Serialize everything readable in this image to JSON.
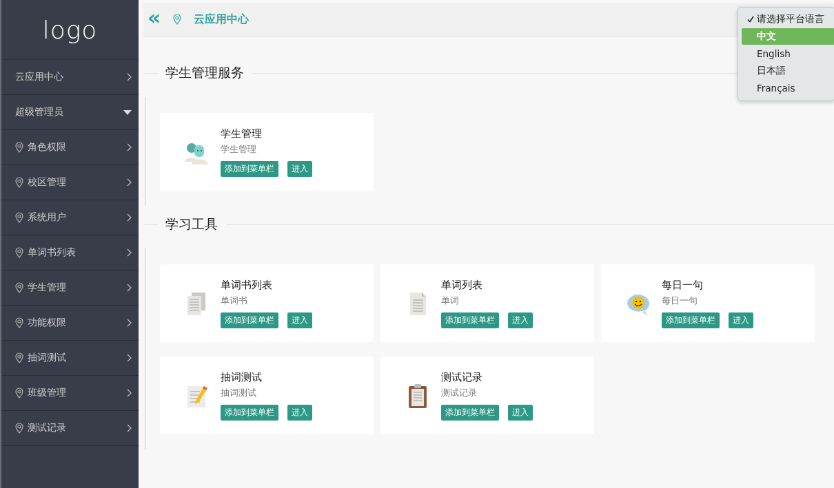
{
  "sidebar": {
    "logo": "logo",
    "items": [
      {
        "label": "云应用中心",
        "expanded": false
      },
      {
        "label": "超级管理员",
        "expanded": true,
        "children": [
          {
            "label": "角色权限",
            "expanded": false
          },
          {
            "label": "校区管理",
            "expanded": false
          },
          {
            "label": "系统用户",
            "expanded": false
          },
          {
            "label": "单词书列表",
            "expanded": false
          },
          {
            "label": "学生管理",
            "expanded": false
          },
          {
            "label": "功能权限",
            "expanded": false
          },
          {
            "label": "抽词测试",
            "expanded": false
          },
          {
            "label": "班级管理",
            "expanded": false
          },
          {
            "label": "测试记录",
            "expanded": false
          }
        ]
      }
    ]
  },
  "header": {
    "collapse_icon": "«",
    "breadcrumb": "云应用中心"
  },
  "language_menu": {
    "options": [
      {
        "label": "请选择平台语言",
        "checked": true,
        "selected": false
      },
      {
        "label": "中文",
        "checked": false,
        "selected": true
      },
      {
        "label": "English",
        "checked": false,
        "selected": false
      },
      {
        "label": "日本語",
        "checked": false,
        "selected": false
      },
      {
        "label": "Français",
        "checked": false,
        "selected": false
      }
    ]
  },
  "sections": [
    {
      "title": "学生管理服务",
      "apps": [
        {
          "kind": "people",
          "name": "学生管理",
          "subtitle": "学生管理",
          "add_button": "添加到菜单栏",
          "enter_button": "进入"
        }
      ]
    },
    {
      "title": "学习工具",
      "apps": [
        {
          "kind": "documents",
          "name": "单词书列表",
          "subtitle": "单词书",
          "add_button": "添加到菜单栏",
          "enter_button": "进入"
        },
        {
          "kind": "document",
          "name": "单词列表",
          "subtitle": "单词",
          "add_button": "添加到菜单栏",
          "enter_button": "进入"
        },
        {
          "kind": "smiley",
          "name": "每日一句",
          "subtitle": "每日一句",
          "add_button": "添加到菜单栏",
          "enter_button": "进入"
        },
        {
          "kind": "notepad",
          "name": "抽词测试",
          "subtitle": "抽词测试",
          "add_button": "添加到菜单栏",
          "enter_button": "进入"
        },
        {
          "kind": "clipboard",
          "name": "测试记录",
          "subtitle": "测试记录",
          "add_button": "添加到菜单栏",
          "enter_button": "进入"
        }
      ]
    }
  ]
}
